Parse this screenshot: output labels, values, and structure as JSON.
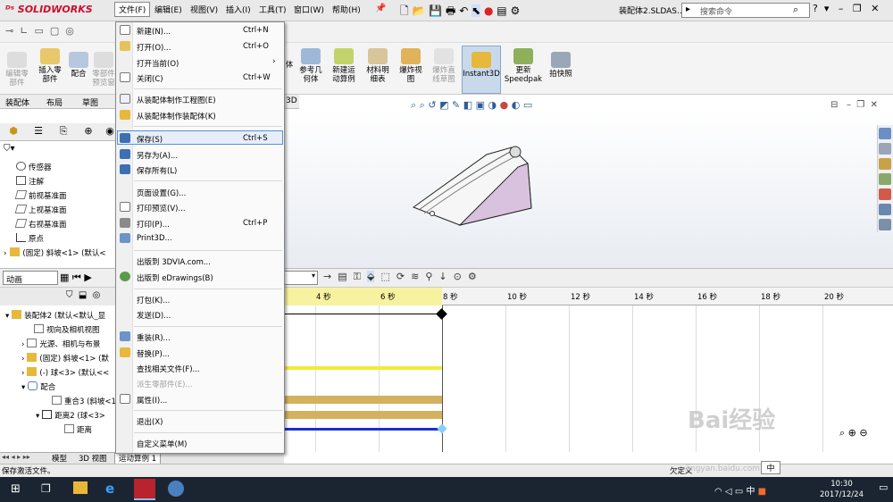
{
  "app": {
    "logo_text": "SOLIDWORKS",
    "doc_title": "装配体2.SLDAS...",
    "search_placeholder": "搜索命令"
  },
  "menubar": [
    "文件(F)",
    "编辑(E)",
    "视图(V)",
    "插入(I)",
    "工具(T)",
    "窗口(W)",
    "帮助(H)"
  ],
  "command_manager": {
    "left_buttons": [
      {
        "label": "编辑零\n部件",
        "enabled": false
      },
      {
        "label": "插入零\n部件",
        "enabled": true
      },
      {
        "label": "配合",
        "enabled": true
      },
      {
        "label": "零部件\n预览窗",
        "enabled": false
      }
    ],
    "right_buttons": [
      {
        "label": "体",
        "enabled": true
      },
      {
        "label": "参考几\n何体",
        "enabled": true
      },
      {
        "label": "新建运\n动算例",
        "enabled": true
      },
      {
        "label": "材料明\n细表",
        "enabled": true
      },
      {
        "label": "爆炸视\n图",
        "enabled": true
      },
      {
        "label": "爆炸直\n线草图",
        "enabled": false
      },
      {
        "label": "Instant3D",
        "enabled": true
      },
      {
        "label": "更新\nSpeedpak",
        "enabled": true
      },
      {
        "label": "拍快照",
        "enabled": true
      }
    ],
    "tabs": [
      "装配体",
      "布局",
      "草图"
    ],
    "tab_3d": "3D"
  },
  "feature_tree": [
    {
      "label": "传感器",
      "icon": "sensor-icon"
    },
    {
      "label": "注解",
      "icon": "annotation-icon"
    },
    {
      "label": "前视基准面",
      "icon": "plane-icon"
    },
    {
      "label": "上视基准面",
      "icon": "plane-icon"
    },
    {
      "label": "右视基准面",
      "icon": "plane-icon"
    },
    {
      "label": "原点",
      "icon": "origin-icon"
    },
    {
      "label": "(固定) 斜坡<1> (默认<",
      "icon": "part-icon"
    }
  ],
  "motion": {
    "type": "动画",
    "tree": [
      {
        "label": "装配体2 (默认<默认_显",
        "level": 0
      },
      {
        "label": "视向及相机视图",
        "level": 1
      },
      {
        "label": "光源、相机与布景",
        "level": 1
      },
      {
        "label": "(固定) 斜坡<1> (默",
        "level": 1
      },
      {
        "label": "(-) 球<3> (默认<<",
        "level": 1
      },
      {
        "label": "配合",
        "level": 1
      },
      {
        "label": "重合3 (斜坡<1",
        "level": 2
      },
      {
        "label": "距离2 (球<3>",
        "level": 2
      },
      {
        "label": "距离",
        "level": 3
      }
    ],
    "ticks": [
      "4 秒",
      "6 秒",
      "8 秒",
      "10 秒",
      "12 秒",
      "14 秒",
      "16 秒",
      "18 秒",
      "20 秒"
    ]
  },
  "file_menu": [
    {
      "label": "新建(N)...",
      "shortcut": "Ctrl+N",
      "icon": "new-icon"
    },
    {
      "label": "打开(O)...",
      "shortcut": "Ctrl+O",
      "icon": "open-icon"
    },
    {
      "label": "打开当前(O)",
      "shortcut": "",
      "submenu": true
    },
    {
      "label": "关闭(C)",
      "shortcut": "Ctrl+W",
      "icon": "close-doc-icon"
    },
    {
      "sep": true
    },
    {
      "label": "从装配体制作工程图(E)",
      "icon": "drawing-icon"
    },
    {
      "label": "从装配体制作装配体(K)",
      "icon": "assembly-icon"
    },
    {
      "sep": true
    },
    {
      "label": "保存(S)",
      "shortcut": "Ctrl+S",
      "icon": "save-icon",
      "highlight": true
    },
    {
      "label": "另存为(A)...",
      "icon": "save-as-icon"
    },
    {
      "label": "保存所有(L)",
      "icon": "save-all-icon"
    },
    {
      "sep": true
    },
    {
      "label": "页面设置(G)...",
      "icon": "page-setup-icon"
    },
    {
      "label": "打印预览(V)...",
      "icon": "print-preview-icon"
    },
    {
      "label": "打印(P)...",
      "shortcut": "Ctrl+P",
      "icon": "print-icon"
    },
    {
      "label": "Print3D...",
      "icon": "print3d-icon"
    },
    {
      "sep": true
    },
    {
      "label": "出版到 3DVIA.com..."
    },
    {
      "label": "出版到 eDrawings(B)",
      "icon": "edrawings-icon"
    },
    {
      "sep": true
    },
    {
      "label": "打包(K)..."
    },
    {
      "label": "发送(D)..."
    },
    {
      "sep": true
    },
    {
      "label": "重装(R)...",
      "icon": "reload-icon"
    },
    {
      "label": "替换(P)...",
      "icon": "replace-icon"
    },
    {
      "label": "查找相关文件(F)..."
    },
    {
      "label": "派生零部件(E)...",
      "disabled": true
    },
    {
      "label": "属性(I)...",
      "icon": "properties-icon"
    },
    {
      "sep": true
    },
    {
      "label": "退出(X)"
    },
    {
      "sep": true
    },
    {
      "label": "自定义菜单(M)"
    }
  ],
  "bottom_tabs": [
    "模型",
    "3D 视图",
    "运动算例 1"
  ],
  "status": {
    "left": "保存激活文件。",
    "right": "欠定义",
    "ime": "中"
  },
  "taskbar": {
    "time": "10:30",
    "date": "2017/12/24",
    "ime": "中"
  },
  "watermark": {
    "text": "Bai经验",
    "url": "jingyan.baidu.com"
  }
}
